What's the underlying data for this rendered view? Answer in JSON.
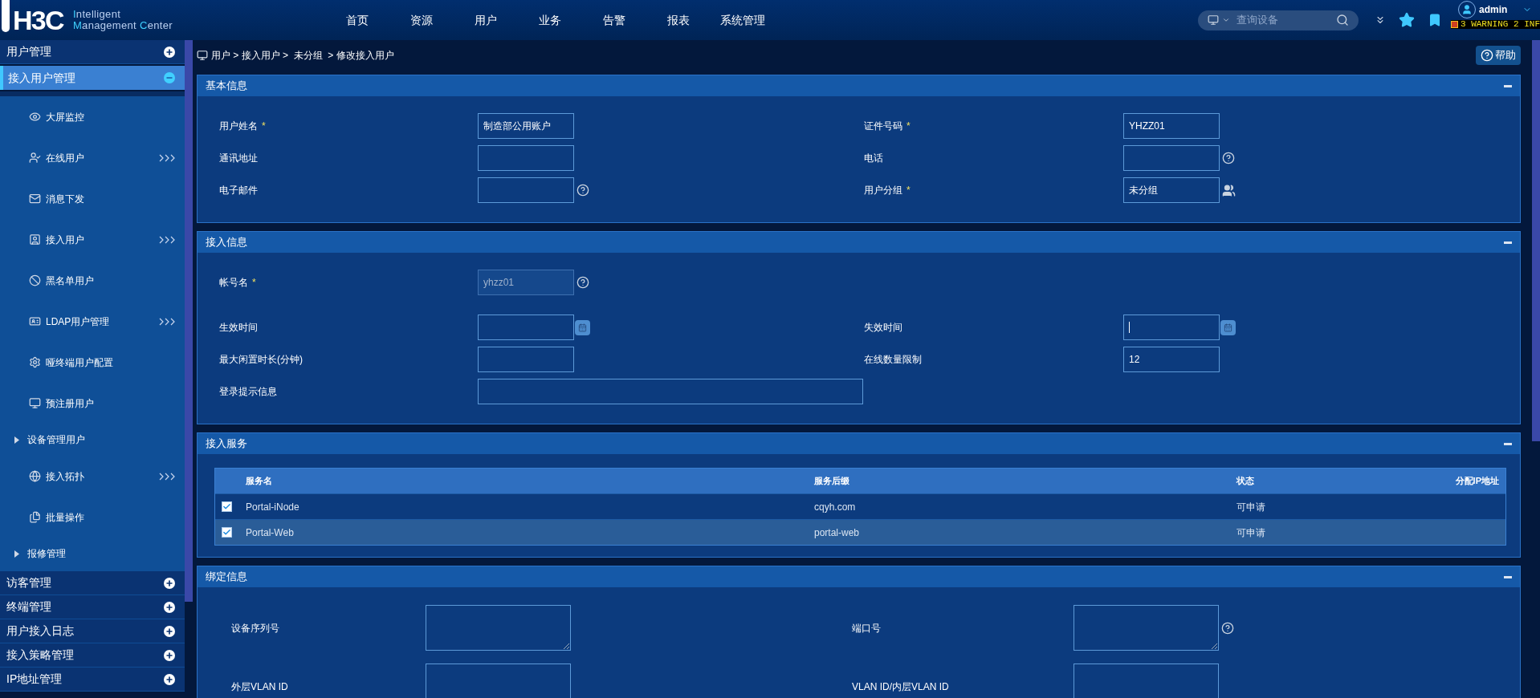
{
  "header": {
    "logo_mark": "H3C",
    "logo_lines": [
      "Intelligent",
      "Management Center"
    ],
    "nav": [
      {
        "label": "首页"
      },
      {
        "label": "资源"
      },
      {
        "label": "用户"
      },
      {
        "label": "业务"
      },
      {
        "label": "告警"
      },
      {
        "label": "报表"
      },
      {
        "label": "系统管理"
      }
    ],
    "search": {
      "placeholder": "查询设备"
    },
    "user": "admin",
    "alarm": "3 WARNING 2 INF"
  },
  "sidebar": {
    "groups": [
      {
        "label": "用户管理",
        "expanded": false,
        "selected": false
      },
      {
        "label": "接入用户管理",
        "expanded": true,
        "selected": true,
        "children": [
          {
            "kind": "item",
            "label": "大屏监控",
            "submenu": false
          },
          {
            "kind": "item",
            "label": "在线用户",
            "submenu": true
          },
          {
            "kind": "item",
            "label": "消息下发",
            "submenu": false
          },
          {
            "kind": "item",
            "label": "接入用户",
            "submenu": true
          },
          {
            "kind": "item",
            "label": "黑名单用户",
            "submenu": false
          },
          {
            "kind": "item",
            "label": "LDAP用户管理",
            "submenu": true
          },
          {
            "kind": "item",
            "label": "哑终端用户配置",
            "submenu": false
          },
          {
            "kind": "item",
            "label": "预注册用户",
            "submenu": false
          },
          {
            "kind": "folder",
            "label": "设备管理用户"
          },
          {
            "kind": "item",
            "label": "接入拓扑",
            "submenu": true
          },
          {
            "kind": "item",
            "label": "批量操作",
            "submenu": false
          },
          {
            "kind": "folder",
            "label": "报修管理"
          }
        ]
      },
      {
        "label": "访客管理",
        "expanded": false,
        "selected": false
      },
      {
        "label": "终端管理",
        "expanded": false,
        "selected": false
      },
      {
        "label": "用户接入日志",
        "expanded": false,
        "selected": false
      },
      {
        "label": "接入策略管理",
        "expanded": false,
        "selected": false
      },
      {
        "label": "IP地址管理",
        "expanded": false,
        "selected": false
      }
    ]
  },
  "breadcrumb": "用户 > 接入用户 >  未分组  > 修改接入用户",
  "help_button": "帮助",
  "panels": [
    {
      "kind": "form",
      "title": "基本信息",
      "rows": [
        [
          {
            "label": "用户姓名",
            "required": "*",
            "value": "制造部公用账户"
          },
          {
            "label": "证件号码",
            "required": "*",
            "value": "YHZZ01"
          }
        ],
        [
          {
            "label": "通讯地址"
          },
          {
            "label": "电话",
            "help": true
          }
        ],
        [
          {
            "label": "电子邮件",
            "help": true
          },
          {
            "label": "用户分组",
            "required": "*",
            "value": "未分组",
            "group_picker": true
          }
        ]
      ]
    },
    {
      "kind": "form",
      "title": "接入信息",
      "rows": [
        [
          {
            "label": "帐号名",
            "required": "*",
            "value": "yhzz01",
            "disabled": true,
            "help": true
          }
        ],
        [
          {
            "label": "生效时间",
            "calendar": true
          },
          {
            "label": "失效时间",
            "calendar": true,
            "focused": true
          }
        ],
        [
          {
            "label": "最大闲置时长(分钟)"
          },
          {
            "label": "在线数量限制",
            "value": "12"
          }
        ],
        [
          {
            "label": "登录提示信息",
            "wide": true
          }
        ]
      ]
    },
    {
      "kind": "table",
      "title": "接入服务",
      "columns": [
        "服务名",
        "服务后缀",
        "状态",
        "分配IP地址"
      ],
      "rows": [
        {
          "checked": true,
          "selected": false,
          "cells": [
            "Portal-iNode",
            "cqyh.com",
            "可申请"
          ]
        },
        {
          "checked": true,
          "selected": true,
          "cells": [
            "Portal-Web",
            "portal-web",
            "可申请"
          ]
        }
      ]
    },
    {
      "kind": "textareas",
      "title": "绑定信息",
      "rows": [
        [
          {
            "label": "设备序列号"
          },
          {
            "label": "端口号",
            "help": true
          }
        ],
        [
          {
            "label": "外层VLAN ID"
          },
          {
            "label": "VLAN ID/内层VLAN ID"
          }
        ]
      ]
    }
  ]
}
